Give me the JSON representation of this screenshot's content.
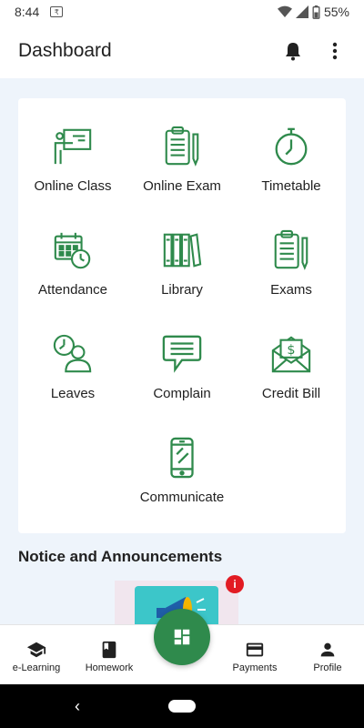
{
  "status_bar": {
    "time": "8:44",
    "currency_icon": "rupee-icon",
    "battery": "55%"
  },
  "app_bar": {
    "title": "Dashboard",
    "notification_icon": "bell-icon",
    "menu_icon": "more-vert-icon"
  },
  "theme": {
    "accent": "#2f8a4c",
    "background": "#eef4fb",
    "badge": "#e21b23"
  },
  "dashboard": {
    "tiles": [
      {
        "label": "Online Class",
        "icon": "presentation-icon"
      },
      {
        "label": "Online Exam",
        "icon": "clipboard-pencil-icon"
      },
      {
        "label": "Timetable",
        "icon": "stopwatch-icon"
      },
      {
        "label": "Attendance",
        "icon": "calendar-clock-icon"
      },
      {
        "label": "Library",
        "icon": "books-icon"
      },
      {
        "label": "Exams",
        "icon": "clipboard-pencil-icon"
      },
      {
        "label": "Leaves",
        "icon": "person-clock-icon"
      },
      {
        "label": "Complain",
        "icon": "message-icon"
      },
      {
        "label": "Credit Bill",
        "icon": "money-envelope-icon"
      },
      {
        "label": "Communicate",
        "icon": "smartphone-icon"
      }
    ]
  },
  "notices": {
    "title": "Notice and Announcements",
    "badge": "i"
  },
  "bottom_nav": {
    "items": [
      {
        "label": "e-Learning",
        "icon": "graduation-cap-icon"
      },
      {
        "label": "Homework",
        "icon": "book-icon"
      },
      {
        "label": "Payments",
        "icon": "credit-card-icon"
      },
      {
        "label": "Profile",
        "icon": "person-icon"
      }
    ],
    "fab_icon": "dashboard-grid-icon"
  },
  "system_nav": {
    "back": "‹"
  }
}
